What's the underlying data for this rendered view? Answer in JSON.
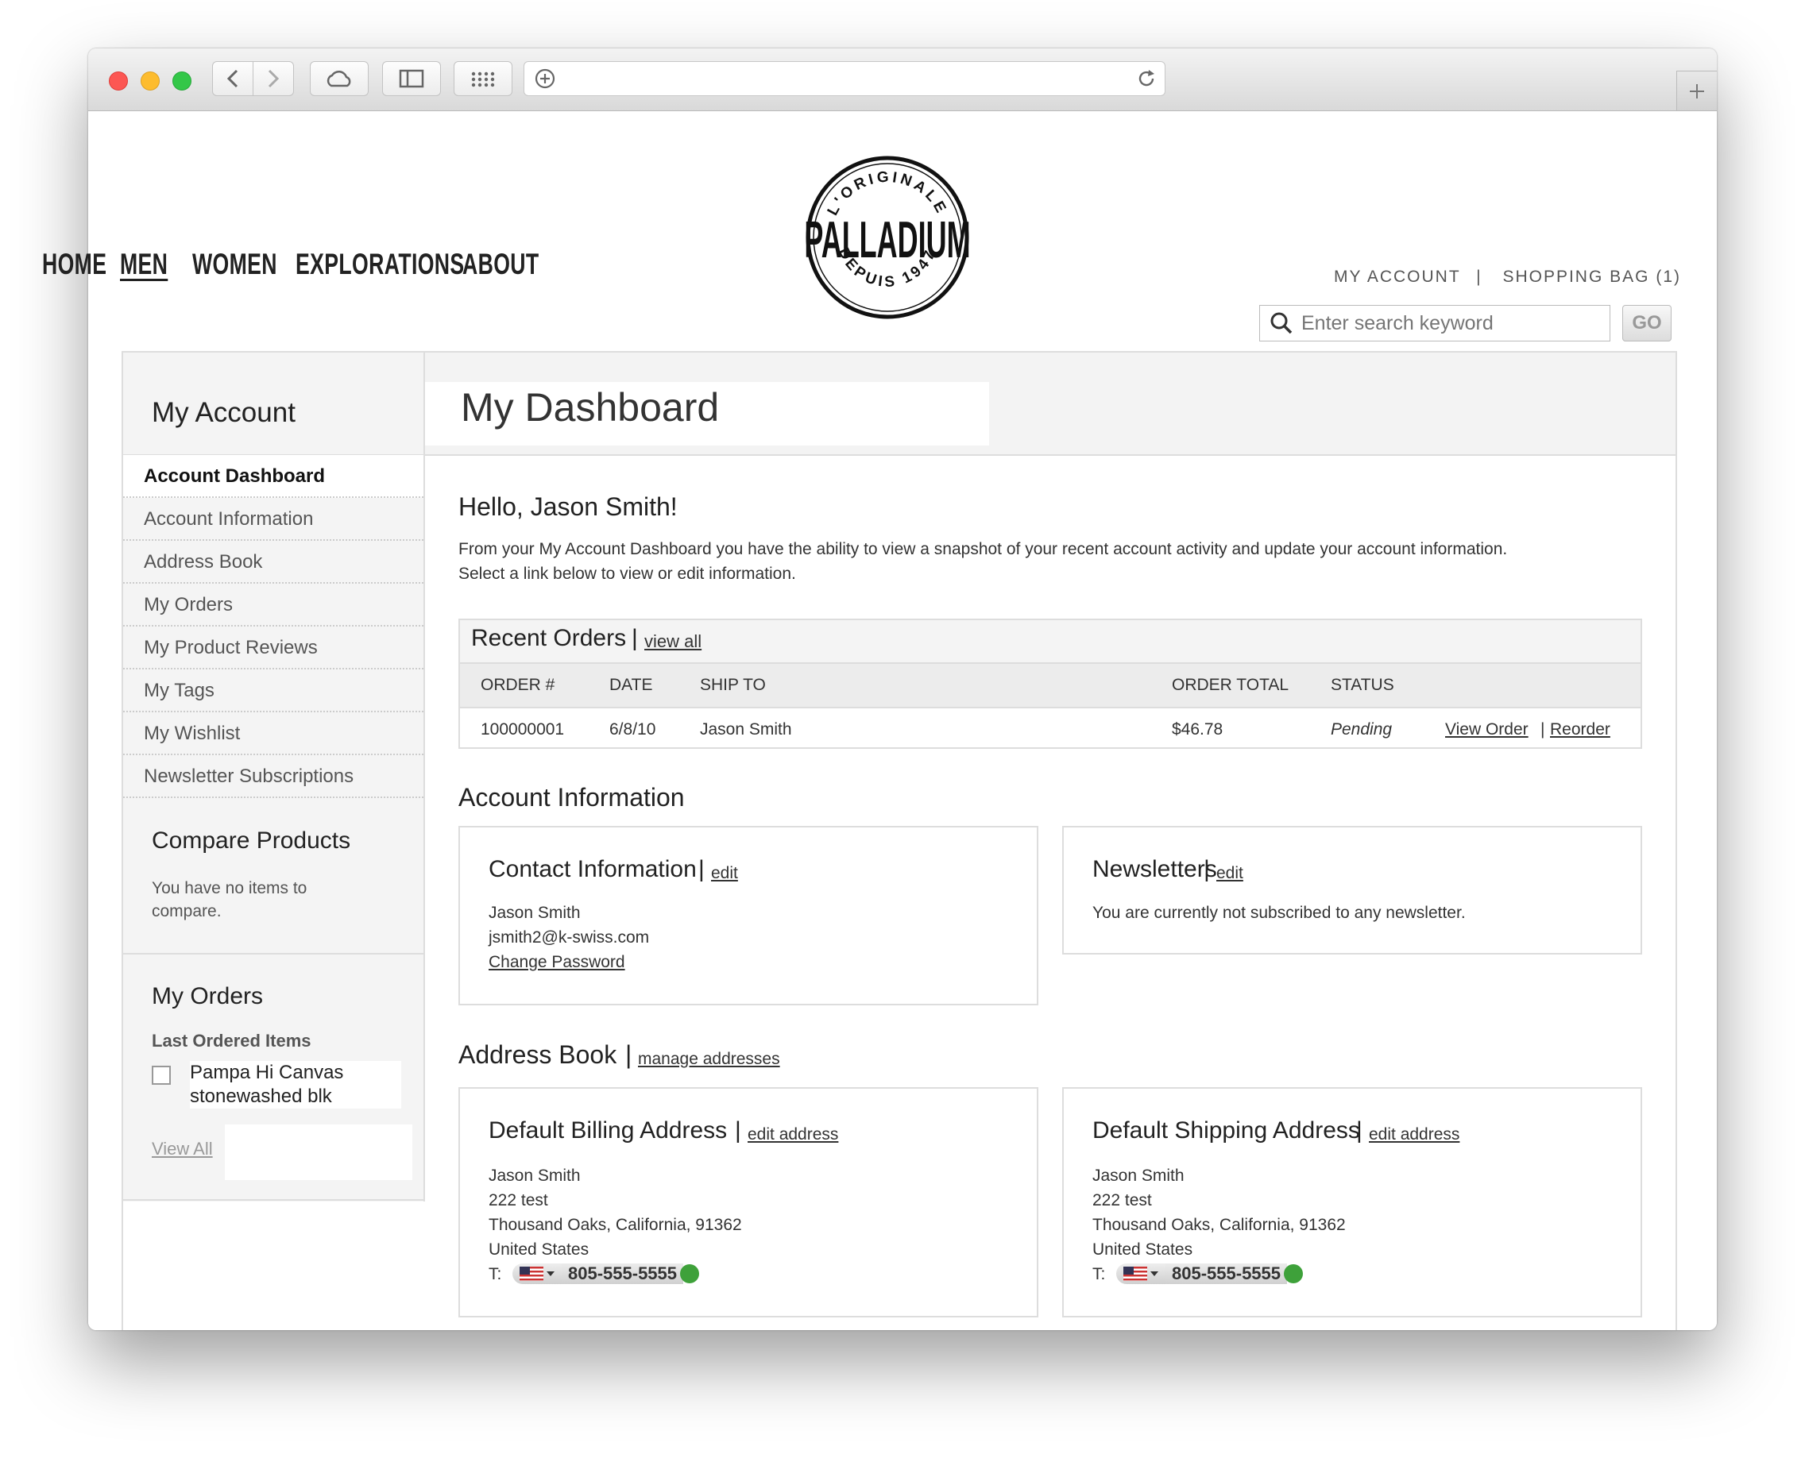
{
  "browser": {
    "traffic_lights": {
      "close": "#fc5753",
      "minimize": "#fdbc2e",
      "zoom": "#33c748"
    }
  },
  "site": {
    "logo_text": "PALLADIUM",
    "logo_top": "L'ORIGINALE",
    "logo_bottom": "DEPUIS 1947",
    "nav": [
      "HOME",
      "MEN",
      "WOMEN",
      "EXPLORATIONS",
      "ABOUT"
    ],
    "active_nav": "MEN",
    "top_links": {
      "my_account": "MY ACCOUNT",
      "separator": "|",
      "shopping_bag": "SHOPPING BAG (1)"
    },
    "search": {
      "placeholder": "Enter search keyword",
      "go_label": "GO"
    }
  },
  "sidebar": {
    "title": "My Account",
    "menu": [
      {
        "label": "Account Dashboard",
        "active": true
      },
      {
        "label": "Account Information"
      },
      {
        "label": "Address Book"
      },
      {
        "label": "My Orders"
      },
      {
        "label": "My Product Reviews"
      },
      {
        "label": "My Tags"
      },
      {
        "label": "My Wishlist"
      },
      {
        "label": "Newsletter Subscriptions"
      }
    ],
    "compare": {
      "title": "Compare Products",
      "text": "You have no items to compare."
    },
    "my_orders": {
      "title": "My Orders",
      "subtitle": "Last Ordered Items",
      "item": "Pampa Hi Canvas stonewashed blk",
      "view_all": "View All"
    }
  },
  "main": {
    "title": "My Dashboard",
    "greeting": "Hello, Jason Smith!",
    "intro_line1": "From your My Account Dashboard you have the ability to view a snapshot of your recent account activity and update your account information.",
    "intro_line2": "Select a link below to view or edit information.",
    "recent_orders": {
      "title": "Recent Orders",
      "view_all": "view all",
      "columns": [
        "ORDER #",
        "DATE",
        "SHIP TO",
        "ORDER TOTAL",
        "STATUS"
      ],
      "rows": [
        {
          "order": "100000001",
          "date": "6/8/10",
          "ship_to": "Jason Smith",
          "total": "$46.78",
          "status": "Pending",
          "view": "View Order",
          "reorder": "Reorder"
        }
      ]
    },
    "account_info": {
      "title": "Account Information",
      "contact": {
        "title": "Contact Information",
        "edit": "edit",
        "name": "Jason Smith",
        "email": "jsmith2@k-swiss.com",
        "change_password": "Change Password"
      },
      "newsletters": {
        "title": "Newsletters",
        "edit": "edit",
        "text": "You are currently not subscribed to any newsletter."
      }
    },
    "address_book": {
      "title": "Address Book",
      "manage": "manage addresses",
      "billing": {
        "title": "Default Billing Address",
        "edit": "edit address",
        "name": "Jason Smith",
        "street": "222 test",
        "city": "Thousand Oaks, California, 91362",
        "country": "United States",
        "phone_label": "T:",
        "phone": "805-555-5555"
      },
      "shipping": {
        "title": "Default Shipping Address",
        "edit": "edit address",
        "name": "Jason Smith",
        "street": "222 test",
        "city": "Thousand Oaks, California, 91362",
        "country": "United States",
        "phone_label": "T:",
        "phone": "805-555-5555"
      }
    }
  }
}
